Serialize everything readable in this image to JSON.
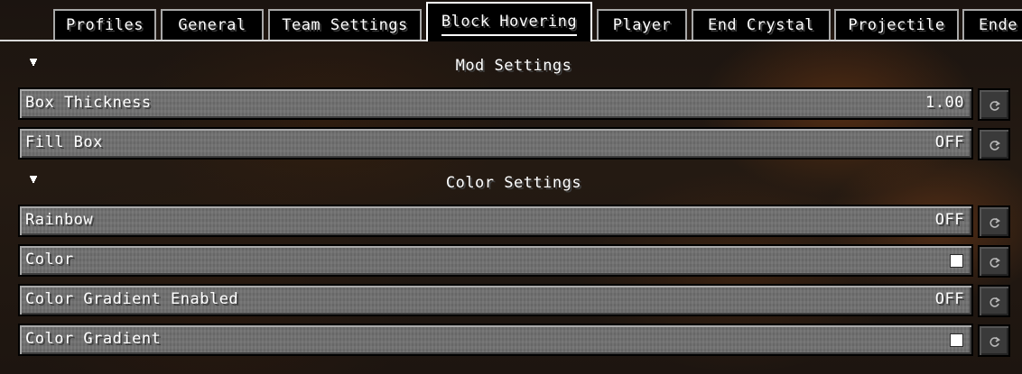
{
  "tabs": [
    {
      "label": "Profiles",
      "active": false
    },
    {
      "label": "General",
      "active": false
    },
    {
      "label": "Team Settings",
      "active": false
    },
    {
      "label": "Block Hovering",
      "active": true
    },
    {
      "label": "Player",
      "active": false
    },
    {
      "label": "End Crystal",
      "active": false
    },
    {
      "label": "Projectile",
      "active": false
    },
    {
      "label": "Ende",
      "active": false
    }
  ],
  "sections": [
    {
      "title": "Mod Settings",
      "expanded": true,
      "settings": [
        {
          "label": "Box Thickness",
          "value": "1.00"
        },
        {
          "label": "Fill Box",
          "value": "OFF"
        }
      ]
    },
    {
      "title": "Color Settings",
      "expanded": true,
      "settings": [
        {
          "label": "Rainbow",
          "value": "OFF"
        },
        {
          "label": "Color",
          "swatch": "#FFFFFF"
        },
        {
          "label": "Color Gradient Enabled",
          "value": "OFF"
        },
        {
          "label": "Color Gradient",
          "swatch": "#FFFFFF"
        }
      ]
    }
  ],
  "icons": {
    "collapse": "triangle-down-icon",
    "reset": "reset-icon"
  },
  "colors": {
    "text": "#FFFFFF",
    "button_face": "#6F6F6F",
    "reset_face": "#3A3A3A",
    "tab_active_border": "#FFFFFF",
    "tab_border": "#A8A8A8"
  }
}
